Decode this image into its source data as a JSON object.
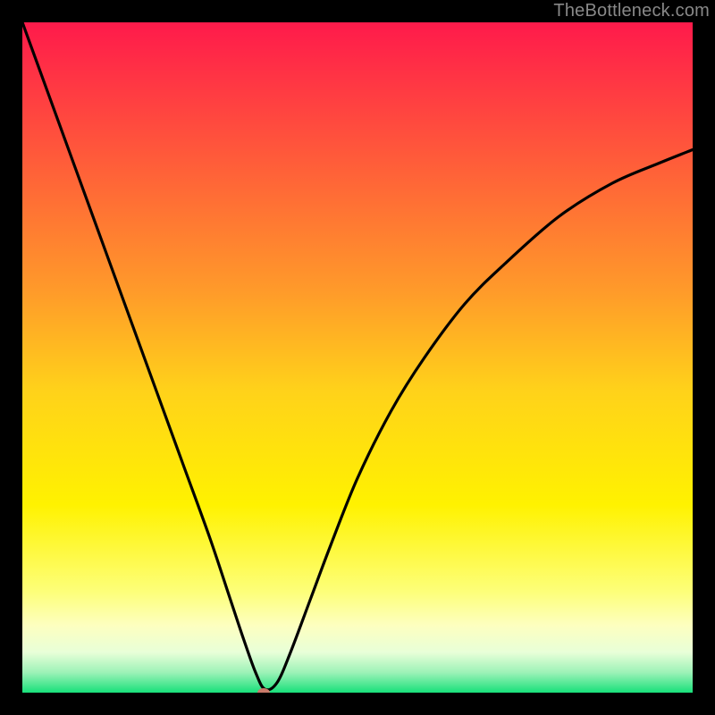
{
  "watermark": "TheBottleneck.com",
  "chart_data": {
    "type": "line",
    "title": "",
    "xlabel": "",
    "ylabel": "",
    "xlim": [
      0,
      100
    ],
    "ylim": [
      0,
      100
    ],
    "grid": false,
    "legend": false,
    "background_gradient_stops": [
      {
        "offset": 0.0,
        "color": "#ff1a4b"
      },
      {
        "offset": 0.2,
        "color": "#ff5a3a"
      },
      {
        "offset": 0.4,
        "color": "#ff9a2a"
      },
      {
        "offset": 0.55,
        "color": "#ffd21a"
      },
      {
        "offset": 0.72,
        "color": "#fff200"
      },
      {
        "offset": 0.85,
        "color": "#fdff7a"
      },
      {
        "offset": 0.9,
        "color": "#fdffc0"
      },
      {
        "offset": 0.94,
        "color": "#e8ffd8"
      },
      {
        "offset": 0.97,
        "color": "#9cf2b7"
      },
      {
        "offset": 1.0,
        "color": "#18e07a"
      }
    ],
    "marker": {
      "x": 36,
      "y": 0,
      "color": "#c97a6a",
      "rx": 7,
      "ry": 5
    },
    "series": [
      {
        "name": "curve",
        "x": [
          0,
          4,
          8,
          12,
          16,
          20,
          24,
          28,
          31,
          33,
          34.8,
          36.2,
          38,
          40,
          43,
          46,
          50,
          55,
          60,
          66,
          72,
          80,
          88,
          95,
          100
        ],
        "y": [
          100,
          89,
          78,
          67,
          56,
          45,
          34,
          23,
          14,
          8,
          3,
          0.5,
          1.5,
          6,
          14,
          22,
          32,
          42,
          50,
          58,
          64,
          71,
          76,
          79,
          81
        ]
      }
    ]
  }
}
